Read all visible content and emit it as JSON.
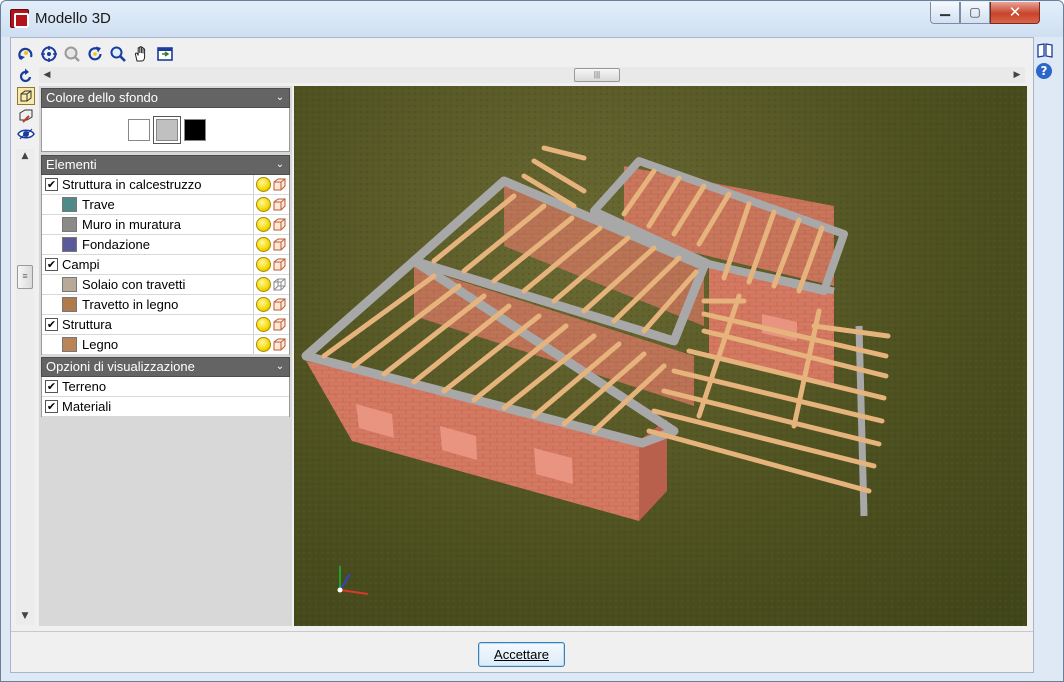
{
  "window": {
    "title": "Modello 3D",
    "controls": {
      "minimize": "▁",
      "maximize": "▢",
      "close": "✕"
    }
  },
  "toolbar": {
    "icons": [
      "rotate-icon",
      "zoom-extents-icon",
      "zoom-window-icon",
      "refresh-icon",
      "zoom-icon",
      "pan-hand-icon",
      "export-view-icon"
    ]
  },
  "left_tools": {
    "icons": [
      "undo-rotate-icon",
      "box-view-icon",
      "layer-view-icon",
      "eye-icon"
    ]
  },
  "right_tools": {
    "icons": [
      "book-icon",
      "help-icon"
    ],
    "help_glyph": "?"
  },
  "sections": {
    "background": {
      "title": "Colore dello sfondo",
      "swatches": [
        {
          "name": "white",
          "color": "#ffffff",
          "selected": false
        },
        {
          "name": "gray",
          "color": "#c0c0c0",
          "selected": true
        },
        {
          "name": "black",
          "color": "#000000",
          "selected": false
        }
      ]
    },
    "elements": {
      "title": "Elementi",
      "rows": [
        {
          "label": "Struttura in calcestruzzo",
          "checked": true,
          "checkmark": "✔"
        },
        {
          "label": "Trave",
          "color": "#4f8a8b"
        },
        {
          "label": "Muro in muratura",
          "color": "#8c8a88"
        },
        {
          "label": "Fondazione",
          "color": "#5a5a9a"
        },
        {
          "label": "Campi",
          "checked": true,
          "checkmark": "✔"
        },
        {
          "label": "Solaio con travetti",
          "color": "#b7ab98"
        },
        {
          "label": "Travetto in legno",
          "color": "#b07b4c"
        },
        {
          "label": "Struttura",
          "checked": true,
          "checkmark": "✔"
        },
        {
          "label": "Legno",
          "color": "#b98557"
        }
      ]
    },
    "display_options": {
      "title": "Opzioni di visualizzazione",
      "rows": [
        {
          "label": "Terreno",
          "checked": true,
          "checkmark": "✔"
        },
        {
          "label": "Materiali",
          "checked": true,
          "checkmark": "✔"
        }
      ]
    }
  },
  "scrollbars": {
    "left_arrow": "◀",
    "right_arrow": "▶",
    "up_arrow": "▲",
    "down_arrow": "▼",
    "grip": "|||",
    "vgrip": "≡"
  },
  "collapse_glyph": "⌄",
  "footer": {
    "accept_label": "Accettare"
  },
  "colors": {
    "brick": "#d2735f",
    "concrete": "#9a9a9a",
    "timber": "#e3b27a",
    "ground": "#51531f"
  }
}
